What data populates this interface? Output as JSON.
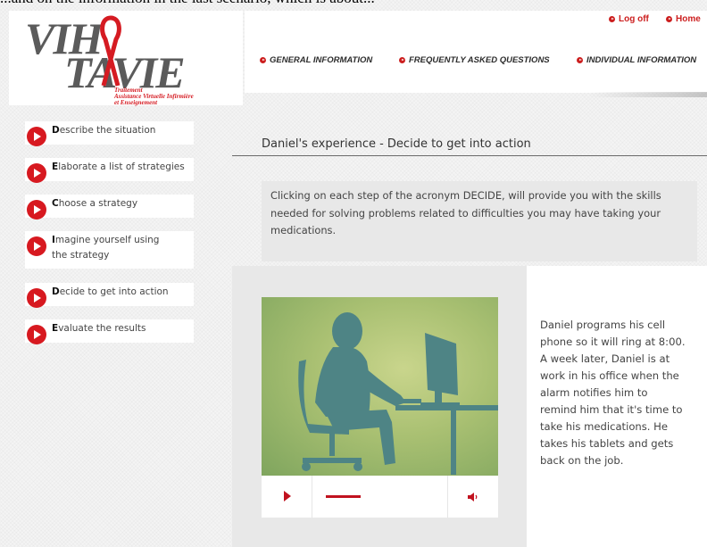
{
  "header_cutoff": "...and on the information in the last scenario, which is about...",
  "logo": {
    "vih": "VIH",
    "tavie": "TAVIE",
    "tagline_1": "Traitement",
    "tagline_2": "Assistance Virtuelle Infirmière",
    "tagline_3": "et Enseignement",
    "ribbon_color": "#d51b22"
  },
  "top_links": {
    "logoff": "Log off",
    "home": "Home"
  },
  "nav": {
    "general": "GENERAL INFORMATION",
    "faq": "FREQUENTLY ASKED QUESTIONS",
    "individual": "INDIVIDUAL INFORMATION"
  },
  "sidebar": {
    "items": [
      {
        "initial": "D",
        "rest": "escribe the situation"
      },
      {
        "initial": "E",
        "rest": "laborate a list of strategies"
      },
      {
        "initial": "C",
        "rest": "hoose a strategy"
      },
      {
        "initial": "I",
        "rest": "magine yourself using the strategy"
      },
      {
        "initial": "D",
        "rest": "ecide to get into action"
      },
      {
        "initial": "E",
        "rest": "valuate the results"
      }
    ]
  },
  "main": {
    "title": "Daniel's experience - Decide to get into action",
    "intro": "Clicking on each step of the acronym DECIDE, will provide you with the skills needed for solving problems related to difficulties you may have taking your medications.",
    "video": {
      "progress": 0.32
    },
    "story": "Daniel programs his cell phone so it will ring at 8:00. A week later, Daniel is at work in his office when the alarm notifies him to remind him that it's time to take his medications. He takes his tablets and gets back on the job."
  },
  "colors": {
    "accent": "#cc1f1f",
    "silhouette": "#4e8485"
  },
  "icons": {
    "play": "play-icon",
    "volume": "volume-icon",
    "bullet": "arrow-bullet-icon"
  }
}
